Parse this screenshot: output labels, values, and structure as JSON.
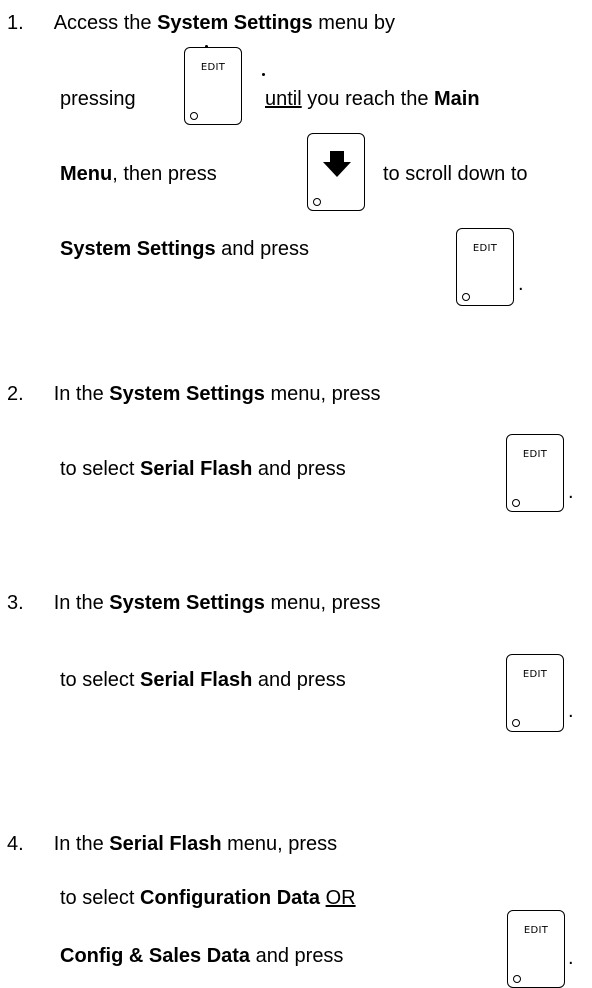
{
  "step1": {
    "number": "1.",
    "l1_a": "Access the ",
    "l1_b": "System Settings",
    "l1_c": " menu by",
    "l2_a": "pressing",
    "l2_b": "until",
    "l2_c": " you reach the ",
    "l2_d": "Main",
    "l3_a": "Menu",
    "l3_b": ", then press",
    "l3_c": "to scroll down to",
    "l4_a": "System Settings",
    "l4_b": " and press",
    "l4_c": "."
  },
  "step2": {
    "number": "2.",
    "l1_a": "In the ",
    "l1_b": "System Settings",
    "l1_c": " menu, press",
    "l2_a": "to select ",
    "l2_b": "Serial Flash",
    "l2_c": " and press",
    "l2_d": "."
  },
  "step3": {
    "number": "3.",
    "l1_a": "In the ",
    "l1_b": "System Settings",
    "l1_c": " menu, press",
    "l2_a": "to select ",
    "l2_b": "Serial Flash",
    "l2_c": " and press",
    "l2_d": "."
  },
  "step4": {
    "number": "4.",
    "l1_a": "In the ",
    "l1_b": "Serial Flash",
    "l1_c": " menu, press",
    "l2_a": "to select ",
    "l2_b": "Configuration Data",
    "l2_c": " ",
    "l2_d": "OR",
    "l3_a": "Config & Sales Data",
    "l3_b": " and press",
    "l3_c": "."
  },
  "keys": {
    "edit_label": "EDIT",
    "down_arrow_icon": "down-arrow-icon",
    "indicator_icon": "indicator-light-icon"
  },
  "colors": {
    "text": "#000000",
    "background": "#ffffff"
  }
}
